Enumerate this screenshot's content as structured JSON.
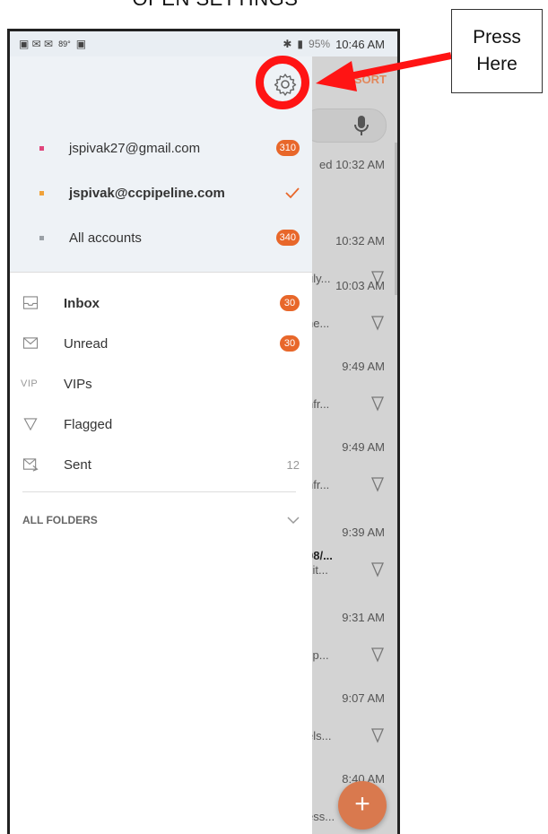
{
  "caption": "OPEN SETTINGS",
  "callout": {
    "text": "Press\nHere"
  },
  "status_bar": {
    "time": "10:46 AM",
    "battery": "95%",
    "temperature": "89°"
  },
  "mail_list": {
    "sort_label": "SORT",
    "rows": [
      {
        "time": "ed 10:32 AM",
        "snippet": ""
      },
      {
        "time": "10:32 AM",
        "snippet": "uly..."
      },
      {
        "time": "10:03 AM",
        "snippet": "he..."
      },
      {
        "time": "9:49 AM",
        "snippet": "nfr..."
      },
      {
        "time": "9:49 AM",
        "snippet": "nfr..."
      },
      {
        "time": "9:39 AM",
        "bold": "08/...",
        "snippet": "xit..."
      },
      {
        "time": "9:31 AM",
        "snippet": "sp..."
      },
      {
        "time": "9:07 AM",
        "snippet": "els..."
      },
      {
        "time": "8:40 AM",
        "snippet": "ess..."
      }
    ],
    "compose_label": "+"
  },
  "drawer": {
    "accounts": [
      {
        "label": "jspivak27@gmail.com",
        "badge": "310",
        "dot_color": "#e0457b"
      },
      {
        "label": "jspivak@ccpipeline.com",
        "selected": true,
        "dot_color": "#f0a23a"
      },
      {
        "label": "All accounts",
        "badge": "340",
        "dot_color": "#9aa0a6"
      }
    ],
    "folders": [
      {
        "label": "Inbox",
        "badge": "30",
        "icon": "inbox-icon"
      },
      {
        "label": "Unread",
        "badge": "30",
        "icon": "envelope-icon"
      },
      {
        "label": "VIPs",
        "icon_text": "VIP"
      },
      {
        "label": "Flagged",
        "icon": "flag-icon"
      },
      {
        "label": "Sent",
        "count": "12",
        "icon": "sent-icon"
      }
    ],
    "all_folders_label": "ALL FOLDERS"
  },
  "colors": {
    "accent": "#e8672a",
    "annotation": "#ff1414",
    "drawer_header": "#eef2f6"
  }
}
